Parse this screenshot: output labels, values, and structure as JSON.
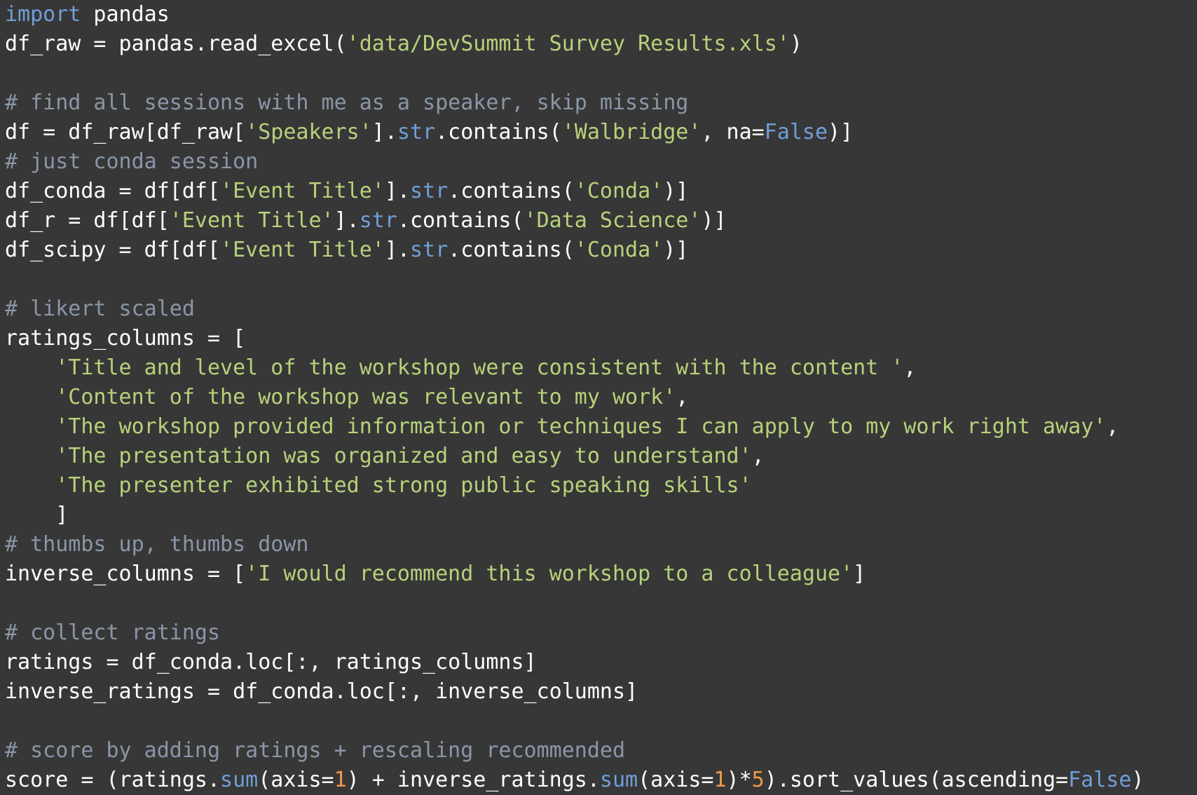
{
  "colors": {
    "background": "#373737",
    "plain": "#ffffff",
    "keyword": "#6f9fd8",
    "comment": "#8a96a8",
    "string": "#b7d27a",
    "builtin": "#6f9fd8",
    "number": "#f09a48"
  },
  "code_lines": [
    [
      [
        "keyword",
        "import"
      ],
      [
        "plain",
        " pandas"
      ]
    ],
    [
      [
        "plain",
        "df_raw = pandas.read_excel("
      ],
      [
        "string",
        "'data/DevSummit Survey Results.xls'"
      ],
      [
        "plain",
        ")"
      ]
    ],
    [],
    [
      [
        "comment",
        "# find all sessions with me as a speaker, skip missing"
      ]
    ],
    [
      [
        "plain",
        "df = df_raw[df_raw["
      ],
      [
        "string",
        "'Speakers'"
      ],
      [
        "plain",
        "]."
      ],
      [
        "builtin",
        "str"
      ],
      [
        "plain",
        ".contains("
      ],
      [
        "string",
        "'Walbridge'"
      ],
      [
        "plain",
        ", na="
      ],
      [
        "builtin",
        "False"
      ],
      [
        "plain",
        ")]"
      ]
    ],
    [
      [
        "comment",
        "# just conda session"
      ]
    ],
    [
      [
        "plain",
        "df_conda = df[df["
      ],
      [
        "string",
        "'Event Title'"
      ],
      [
        "plain",
        "]."
      ],
      [
        "builtin",
        "str"
      ],
      [
        "plain",
        ".contains("
      ],
      [
        "string",
        "'Conda'"
      ],
      [
        "plain",
        ")]"
      ]
    ],
    [
      [
        "plain",
        "df_r = df[df["
      ],
      [
        "string",
        "'Event Title'"
      ],
      [
        "plain",
        "]."
      ],
      [
        "builtin",
        "str"
      ],
      [
        "plain",
        ".contains("
      ],
      [
        "string",
        "'Data Science'"
      ],
      [
        "plain",
        ")]"
      ]
    ],
    [
      [
        "plain",
        "df_scipy = df[df["
      ],
      [
        "string",
        "'Event Title'"
      ],
      [
        "plain",
        "]."
      ],
      [
        "builtin",
        "str"
      ],
      [
        "plain",
        ".contains("
      ],
      [
        "string",
        "'Conda'"
      ],
      [
        "plain",
        ")]"
      ]
    ],
    [],
    [
      [
        "comment",
        "# likert scaled"
      ]
    ],
    [
      [
        "plain",
        "ratings_columns = ["
      ]
    ],
    [
      [
        "plain",
        "    "
      ],
      [
        "string",
        "'Title and level of the workshop were consistent with the content '"
      ],
      [
        "plain",
        ","
      ]
    ],
    [
      [
        "plain",
        "    "
      ],
      [
        "string",
        "'Content of the workshop was relevant to my work'"
      ],
      [
        "plain",
        ","
      ]
    ],
    [
      [
        "plain",
        "    "
      ],
      [
        "string",
        "'The workshop provided information or techniques I can apply to my work right away'"
      ],
      [
        "plain",
        ","
      ]
    ],
    [
      [
        "plain",
        "    "
      ],
      [
        "string",
        "'The presentation was organized and easy to understand'"
      ],
      [
        "plain",
        ","
      ]
    ],
    [
      [
        "plain",
        "    "
      ],
      [
        "string",
        "'The presenter exhibited strong public speaking skills'"
      ]
    ],
    [
      [
        "plain",
        "    ]"
      ]
    ],
    [
      [
        "comment",
        "# thumbs up, thumbs down"
      ]
    ],
    [
      [
        "plain",
        "inverse_columns = ["
      ],
      [
        "string",
        "'I would recommend this workshop to a colleague'"
      ],
      [
        "plain",
        "]"
      ]
    ],
    [],
    [
      [
        "comment",
        "# collect ratings"
      ]
    ],
    [
      [
        "plain",
        "ratings = df_conda.loc[:, ratings_columns]"
      ]
    ],
    [
      [
        "plain",
        "inverse_ratings = df_conda.loc[:, inverse_columns]"
      ]
    ],
    [],
    [
      [
        "comment",
        "# score by adding ratings + rescaling recommended"
      ]
    ],
    [
      [
        "plain",
        "score = (ratings."
      ],
      [
        "builtin",
        "sum"
      ],
      [
        "plain",
        "(axis="
      ],
      [
        "number",
        "1"
      ],
      [
        "plain",
        ") + inverse_ratings."
      ],
      [
        "builtin",
        "sum"
      ],
      [
        "plain",
        "(axis="
      ],
      [
        "number",
        "1"
      ],
      [
        "plain",
        ")*"
      ],
      [
        "number",
        "5"
      ],
      [
        "plain",
        ").sort_values(ascending="
      ],
      [
        "builtin",
        "False"
      ],
      [
        "plain",
        ")"
      ]
    ]
  ]
}
